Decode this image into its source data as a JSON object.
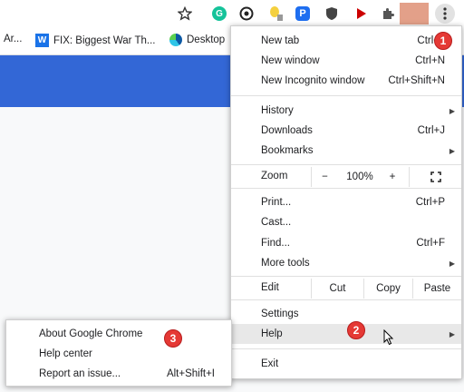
{
  "bookmarks": [
    {
      "label": "Ar..."
    },
    {
      "label": "FIX: Biggest War Th...",
      "icon": "W"
    },
    {
      "label": "Desktop"
    }
  ],
  "menu": {
    "new_tab": {
      "label": "New tab",
      "shortcut": "Ctrl+"
    },
    "new_window": {
      "label": "New window",
      "shortcut": "Ctrl+N"
    },
    "new_incognito": {
      "label": "New Incognito window",
      "shortcut": "Ctrl+Shift+N"
    },
    "history": {
      "label": "History"
    },
    "downloads": {
      "label": "Downloads",
      "shortcut": "Ctrl+J"
    },
    "bookmarks": {
      "label": "Bookmarks"
    },
    "zoom": {
      "label": "Zoom",
      "minus": "−",
      "level": "100%",
      "plus": "+"
    },
    "print": {
      "label": "Print...",
      "shortcut": "Ctrl+P"
    },
    "cast": {
      "label": "Cast..."
    },
    "find": {
      "label": "Find...",
      "shortcut": "Ctrl+F"
    },
    "more_tools": {
      "label": "More tools"
    },
    "edit": {
      "label": "Edit",
      "cut": "Cut",
      "copy": "Copy",
      "paste": "Paste"
    },
    "settings": {
      "label": "Settings"
    },
    "help": {
      "label": "Help"
    },
    "exit": {
      "label": "Exit"
    }
  },
  "submenu": {
    "about": {
      "label": "About Google Chrome"
    },
    "help_center": {
      "label": "Help center"
    },
    "report": {
      "label": "Report an issue...",
      "shortcut": "Alt+Shift+I"
    }
  },
  "badges": {
    "one": "1",
    "two": "2",
    "three": "3"
  },
  "colors": {
    "banner": "#3367d6",
    "badge": "#e53935",
    "highlight": "#e8e8e8"
  }
}
